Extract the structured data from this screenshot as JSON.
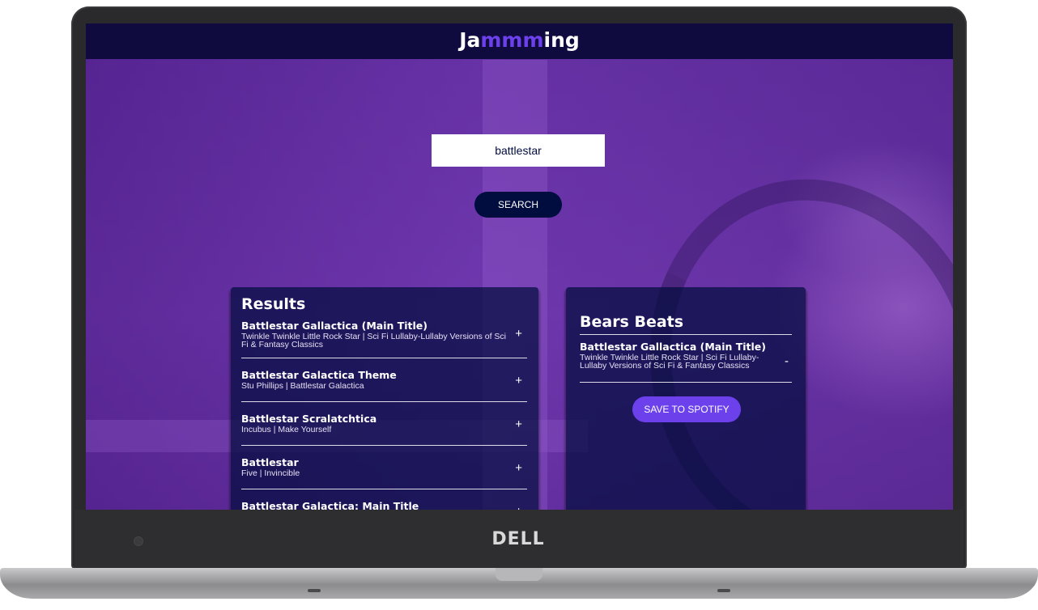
{
  "app": {
    "logo_prefix": "Ja",
    "logo_accent": "mmm",
    "logo_suffix": "ing",
    "accent_color": "#6c41ec",
    "header_color": "#0f0b3f"
  },
  "search": {
    "value": "battlestar",
    "button_label": "SEARCH"
  },
  "results": {
    "title": "Results",
    "tracks": [
      {
        "name": "Battlestar Gallactica (Main Title)",
        "info": "Twinkle Twinkle Little Rock Star | Sci Fi Lullaby-Lullaby Versions of Sci Fi & Fantasy Classics",
        "action": "+"
      },
      {
        "name": "Battlestar Galactica Theme",
        "info": "Stu Phillips | Battlestar Galactica",
        "action": "+"
      },
      {
        "name": "Battlestar Scralatchtica",
        "info": "Incubus | Make Yourself",
        "action": "+"
      },
      {
        "name": "Battlestar",
        "info": "Five | Invincible",
        "action": "+"
      },
      {
        "name": "Battlestar Galactica: Main Title",
        "info": "",
        "action": "+"
      }
    ]
  },
  "playlist": {
    "name": "Bears Beats",
    "tracks": [
      {
        "name": "Battlestar Gallactica (Main Title)",
        "info": "Twinkle Twinkle Little Rock Star | Sci Fi Lullaby-Lullaby Versions of Sci Fi & Fantasy Classics",
        "action": "-"
      }
    ],
    "save_label": "SAVE TO SPOTIFY"
  },
  "device": {
    "brand": "DELL"
  }
}
